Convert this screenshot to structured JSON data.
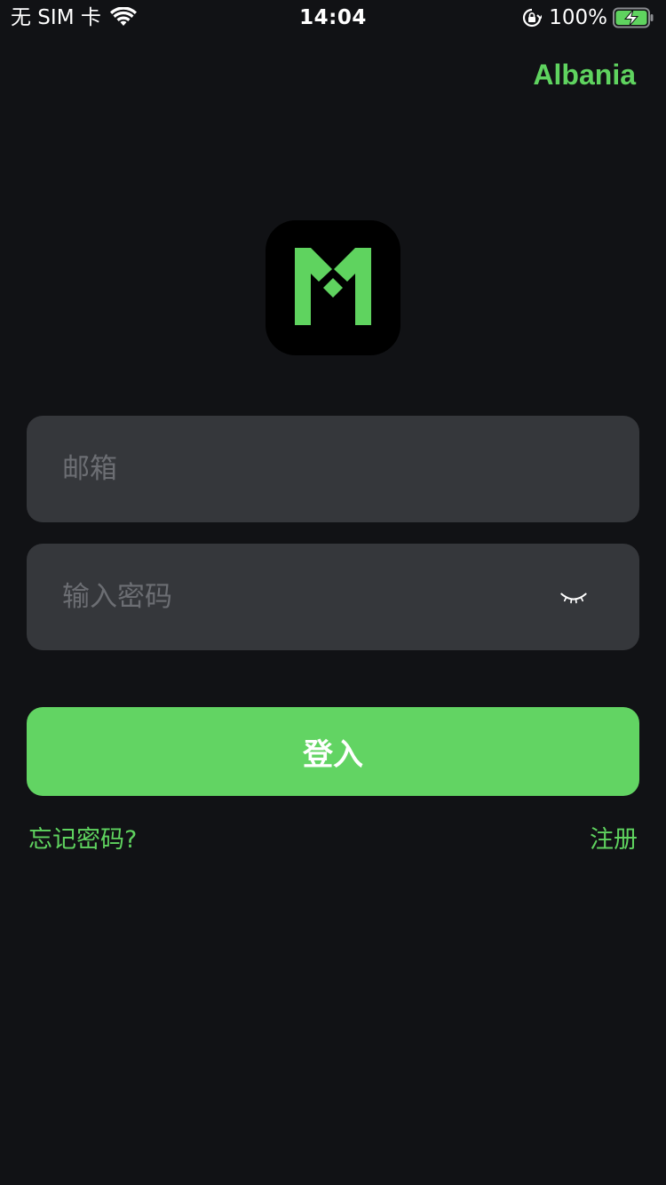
{
  "status_bar": {
    "carrier": "无 SIM 卡",
    "time": "14:04",
    "battery_percent": "100%",
    "battery_level": 1.0,
    "charging": true,
    "icons": [
      "wifi-icon",
      "lock-rotation-icon",
      "battery-charging-icon"
    ]
  },
  "header": {
    "region_label": "Albania"
  },
  "logo": {
    "icon": "app-logo-m-icon",
    "accent_color": "#5fd35f"
  },
  "form": {
    "email": {
      "value": "",
      "placeholder": "邮箱"
    },
    "password": {
      "value": "",
      "placeholder": "输入密码",
      "visibility_icon": "eye-closed-icon"
    },
    "login_label": "登入",
    "forgot_label": "忘记密码?",
    "register_label": "注册"
  },
  "colors": {
    "background": "#111215",
    "field_background": "#35373b",
    "accent": "#62d463",
    "placeholder": "#6c6e73"
  }
}
